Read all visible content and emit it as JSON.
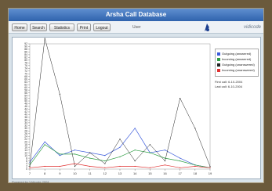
{
  "app": {
    "title": "Arsha Call Database"
  },
  "toolbar": {
    "home": "Home",
    "search": "Search",
    "statistics": "Statistics",
    "print": "Print",
    "logout": "Logout",
    "user": "User",
    "brand": "vidicode"
  },
  "legend": {
    "items": [
      {
        "label": "Outgoing (answered)",
        "color": "#3b5bdb"
      },
      {
        "label": "Incoming (answered)",
        "color": "#2f9e44"
      },
      {
        "label": "Outgoing (unanswered)",
        "color": "#222222"
      },
      {
        "label": "Incoming (unanswered)",
        "color": "#e03131"
      }
    ]
  },
  "meta": {
    "first_call": "First call: 6-10-2004",
    "last_call": "Last call: 6-10-2004"
  },
  "footer": "Powered by Vidicode 2004",
  "chart_data": {
    "type": "line",
    "title": "",
    "xlabel": "",
    "ylabel": "",
    "x": [
      7,
      8,
      9,
      10,
      11,
      12,
      13,
      14,
      15,
      16,
      17,
      18,
      19
    ],
    "ylim": [
      0,
      92
    ],
    "yticks": [
      0,
      2,
      4,
      6,
      8,
      10,
      12,
      14,
      16,
      18,
      20,
      22,
      24,
      26,
      28,
      30,
      32,
      34,
      36,
      38,
      40,
      42,
      44,
      46,
      48,
      50,
      52,
      54,
      56,
      58,
      60,
      62,
      64,
      66,
      68,
      70,
      72,
      74,
      76,
      78,
      80,
      82,
      84,
      86,
      88,
      90,
      92
    ],
    "series": [
      {
        "name": "Outgoing (answered)",
        "color": "#3b5bdb",
        "values": [
          5,
          20,
          10,
          14,
          12,
          10,
          16,
          30,
          12,
          14,
          8,
          3,
          1
        ]
      },
      {
        "name": "Incoming (answered)",
        "color": "#2f9e44",
        "values": [
          3,
          18,
          11,
          11,
          8,
          6,
          9,
          14,
          12,
          8,
          6,
          3,
          1
        ]
      },
      {
        "name": "Outgoing (unanswered)",
        "color": "#222222",
        "values": [
          2,
          96,
          55,
          2,
          12,
          4,
          22,
          6,
          18,
          6,
          52,
          30,
          2
        ]
      },
      {
        "name": "Incoming (unanswered)",
        "color": "#e03131",
        "values": [
          1,
          2,
          2,
          4,
          2,
          1,
          2,
          2,
          1,
          3,
          1,
          2,
          1
        ]
      }
    ]
  }
}
